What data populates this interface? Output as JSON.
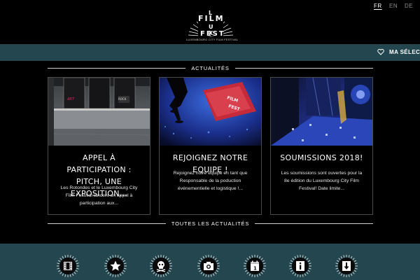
{
  "languages": [
    {
      "label": "FR",
      "active": true
    },
    {
      "label": "EN",
      "active": false
    },
    {
      "label": "DE",
      "active": false
    }
  ],
  "logo": {
    "word_film": "FILM",
    "word_fest": "FEST",
    "subtitle": "LUXEMBOURG CITY FILM FESTIVAL"
  },
  "topbar": {
    "selection_label": "MA SÉLECTION",
    "heart_icon": "heart-icon"
  },
  "news_section": {
    "title": "ACTUALITÉS",
    "cards": [
      {
        "title_line1": "APPEL À PARTICIPATION :",
        "title_line2": "PITCH, UNE EXPOSITION...",
        "text_line1": "Les Rotondes et le Luxembourg City",
        "text_line2": "Film Festival lancent un appel à",
        "text_line3": "participation aux...",
        "poster_labels": [
          "ART",
          "",
          "ROCK"
        ]
      },
      {
        "title_line1": "REJOIGNEZ NOTRE EQUIPE !",
        "title_line2": "",
        "text_line1": "Rejoignez notre équipe en tant que",
        "text_line2": "Responsable de la poduction",
        "text_line3": "événementielle et logistique !..."
      },
      {
        "title_line1": "SOUMISSIONS 2018!",
        "title_line2": "",
        "text_line1": "Les soumissions sont ouvertes pour la",
        "text_line2": "8e édition du Luxembourg City Film",
        "text_line3": "Festival! Date limite..."
      }
    ],
    "all_news_label": "TOUTES LES ACTUALITÉS"
  },
  "bottom_icons": [
    "film-icon",
    "star-icon",
    "skull-icon",
    "camera-icon",
    "calendar-icon",
    "info-icon",
    "download-icon"
  ],
  "colors": {
    "background": "#000000",
    "teal": "#24474f",
    "text": "#ffffff",
    "muted": "#8c8c8c"
  }
}
